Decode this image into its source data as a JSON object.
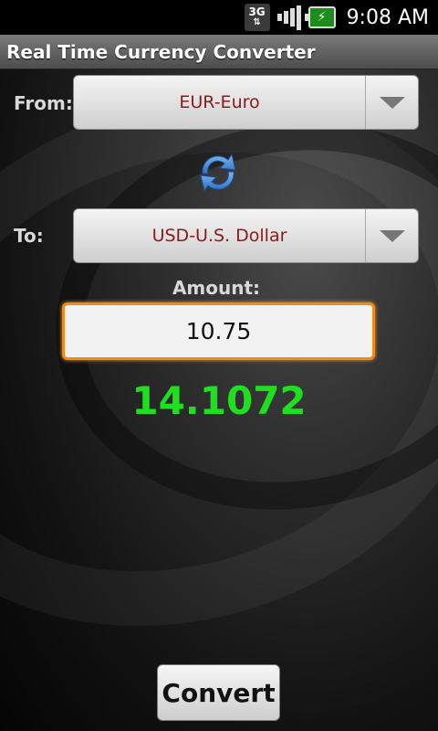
{
  "status_bar": {
    "time": "9:08 AM",
    "network_label": "3G",
    "icons": [
      "network-3g-icon",
      "signal-strength-icon",
      "battery-charging-icon"
    ]
  },
  "app": {
    "title": "Real Time Currency Converter"
  },
  "form": {
    "from_label": "From:",
    "from_value": "EUR-Euro",
    "to_label": "To:",
    "to_value": "USD-U.S. Dollar",
    "amount_label": "Amount:",
    "amount_value": "10.75",
    "result": "14.1072",
    "convert_label": "Convert"
  },
  "colors": {
    "result_color": "#1fe01f",
    "focus_border": "#f08a1a",
    "spinner_text": "#8b1a1a",
    "swap_icon": "#4a90d9"
  }
}
